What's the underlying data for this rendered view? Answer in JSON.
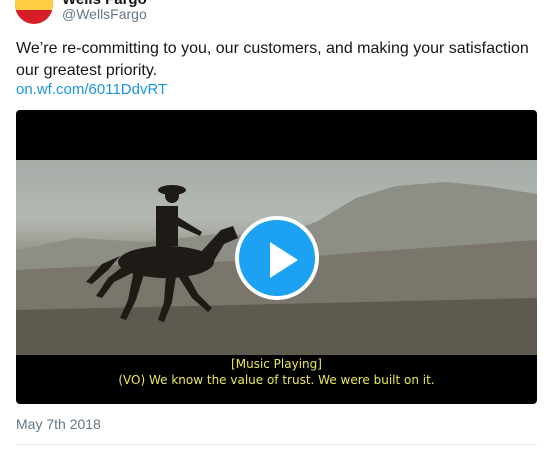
{
  "author": {
    "display_name": "Wells Fargo",
    "handle": "@WellsFargo"
  },
  "tweet": {
    "text": "We’re re-committing to you, our customers, and making your satisfaction our greatest priority.",
    "link": "on.wf.com/6011DdvRT"
  },
  "video": {
    "caption_line_1": "[Music Playing]",
    "caption_line_2": "(VO) We know the value of trust. We were built on it.",
    "play_icon": "play-icon"
  },
  "timestamp": "May 7th 2018",
  "colors": {
    "link": "#1b95e0",
    "play_button": "#1da1f2",
    "caption": "#e8e85a",
    "brand_red": "#d71e28",
    "brand_yellow": "#ffcd41"
  }
}
